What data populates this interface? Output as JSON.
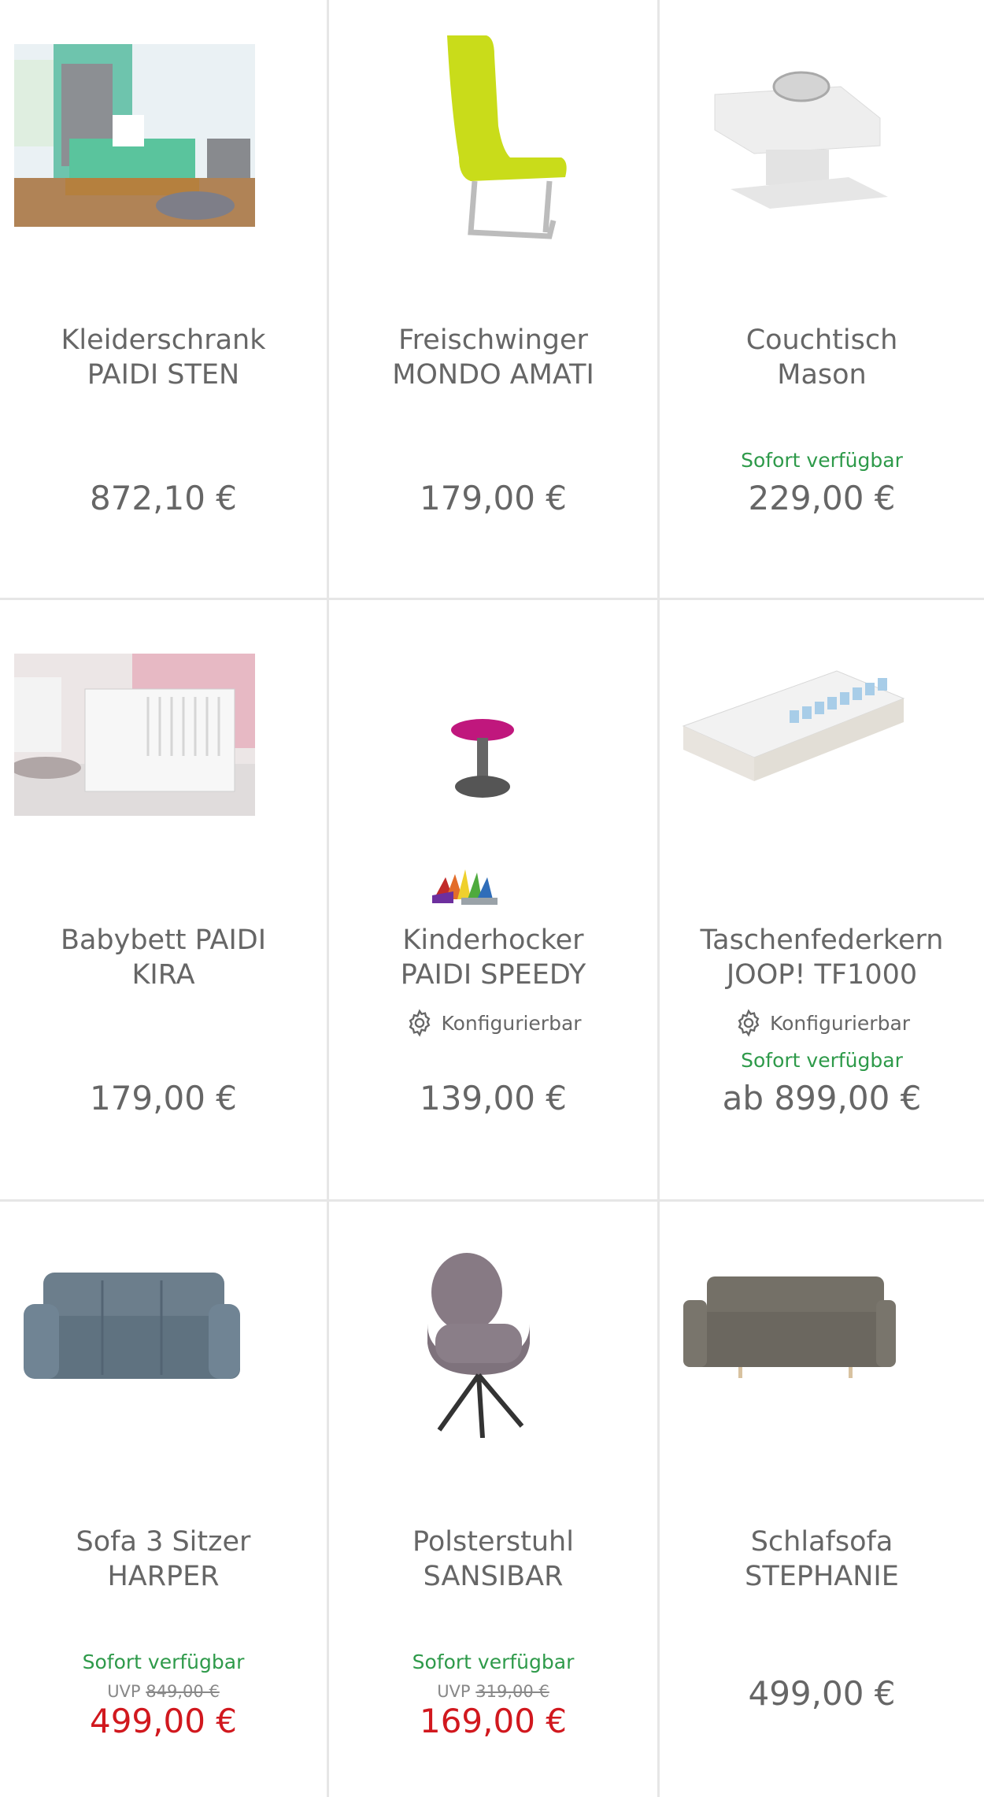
{
  "products": [
    {
      "title_line1": "Kleiderschrank",
      "title_line2": "PAIDI STEN",
      "price": "872,10 €",
      "image_icon": "bedroom-photo"
    },
    {
      "title_line1": "Freischwinger",
      "title_line2": "MONDO AMATI",
      "price": "179,00 €",
      "image_icon": "cantilever-chair-photo"
    },
    {
      "title_line1": "Couchtisch",
      "title_line2": "Mason",
      "availability": "Sofort verfügbar",
      "price": "229,00 €",
      "image_icon": "coffee-table-photo"
    },
    {
      "title_line1": "Babybett PAIDI",
      "title_line2": "KIRA",
      "price": "179,00 €",
      "image_icon": "crib-photo"
    },
    {
      "title_line1": "Kinderhocker",
      "title_line2": "PAIDI SPEEDY",
      "config": "Konfigurierbar",
      "price": "139,00 €",
      "image_icon": "stool-photo"
    },
    {
      "title_line1": "Taschenfederkern",
      "title_line2": "JOOP! TF1000",
      "config": "Konfigurierbar",
      "availability": "Sofort verfügbar",
      "price": "ab 899,00 €",
      "image_icon": "mattress-photo"
    },
    {
      "title_line1": "Sofa 3 Sitzer",
      "title_line2": "HARPER",
      "availability": "Sofort verfügbar",
      "uvp_label": "UVP",
      "uvp_price": "849,00 €",
      "price": "499,00 €",
      "image_icon": "recliner-sofa-photo"
    },
    {
      "title_line1": "Polsterstuhl",
      "title_line2": "SANSIBAR",
      "availability": "Sofort verfügbar",
      "uvp_label": "UVP",
      "uvp_price": "319,00 €",
      "price": "169,00 €",
      "image_icon": "upholstered-chair-photo"
    },
    {
      "title_line1": "Schlafsofa",
      "title_line2": "STEPHANIE",
      "price": "499,00 €",
      "image_icon": "sleeper-sofa-photo"
    }
  ],
  "colors": {
    "availability": "#2e9a4a",
    "sale_price": "#d1181e",
    "text": "#666666",
    "border": "#e6e6e6"
  }
}
